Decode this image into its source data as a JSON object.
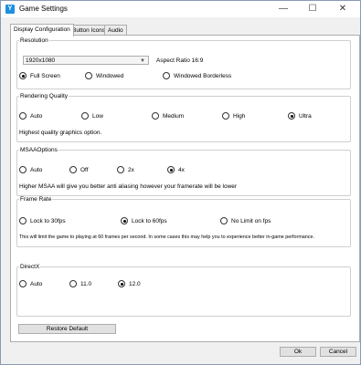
{
  "window": {
    "title": "Game Settings",
    "icon_char": "Y"
  },
  "controls": {
    "minimize": "—",
    "maximize": "☐",
    "close": "✕"
  },
  "tabs": [
    {
      "label": "Display Configuration",
      "active": true
    },
    {
      "label": "Button Icons",
      "active": false
    },
    {
      "label": "Audio",
      "active": false
    }
  ],
  "resolution": {
    "legend": "Resolution",
    "selected": "1920x1080",
    "aspect_ratio": "Aspect Ratio 16:9",
    "modes": [
      {
        "label": "Full Screen",
        "checked": true
      },
      {
        "label": "Windowed",
        "checked": false
      },
      {
        "label": "Windowed Borderless",
        "checked": false
      }
    ]
  },
  "quality": {
    "legend": "Rendering Quality",
    "options": [
      {
        "label": "Auto",
        "checked": false
      },
      {
        "label": "Low",
        "checked": false
      },
      {
        "label": "Medium",
        "checked": false
      },
      {
        "label": "High",
        "checked": false
      },
      {
        "label": "Ultra",
        "checked": true
      }
    ],
    "description": "Highest quality graphics option."
  },
  "msaa": {
    "legend": "MSAAOptions",
    "options": [
      {
        "label": "Auto",
        "checked": false
      },
      {
        "label": "Off",
        "checked": false
      },
      {
        "label": "2x",
        "checked": false
      },
      {
        "label": "4x",
        "checked": true
      }
    ],
    "description": "Higher MSAA will give you better anti aliasing however your framerate will be lower"
  },
  "framerate": {
    "legend": "Frame Rate",
    "options": [
      {
        "label": "Lock  to 30fps",
        "checked": false
      },
      {
        "label": "Lock to 60fps",
        "checked": true
      },
      {
        "label": "No Limit on fps",
        "checked": false
      }
    ],
    "description": "This will limit the game to playing at 60 frames per second. In some cases this may help you to experience better in-game performance."
  },
  "directx": {
    "legend": "DirectX",
    "options": [
      {
        "label": "Auto",
        "checked": false
      },
      {
        "label": "11.0",
        "checked": false
      },
      {
        "label": "12.0",
        "checked": true
      }
    ]
  },
  "buttons": {
    "restore": "Restore Default",
    "ok": "Ok",
    "cancel": "Cancel"
  }
}
